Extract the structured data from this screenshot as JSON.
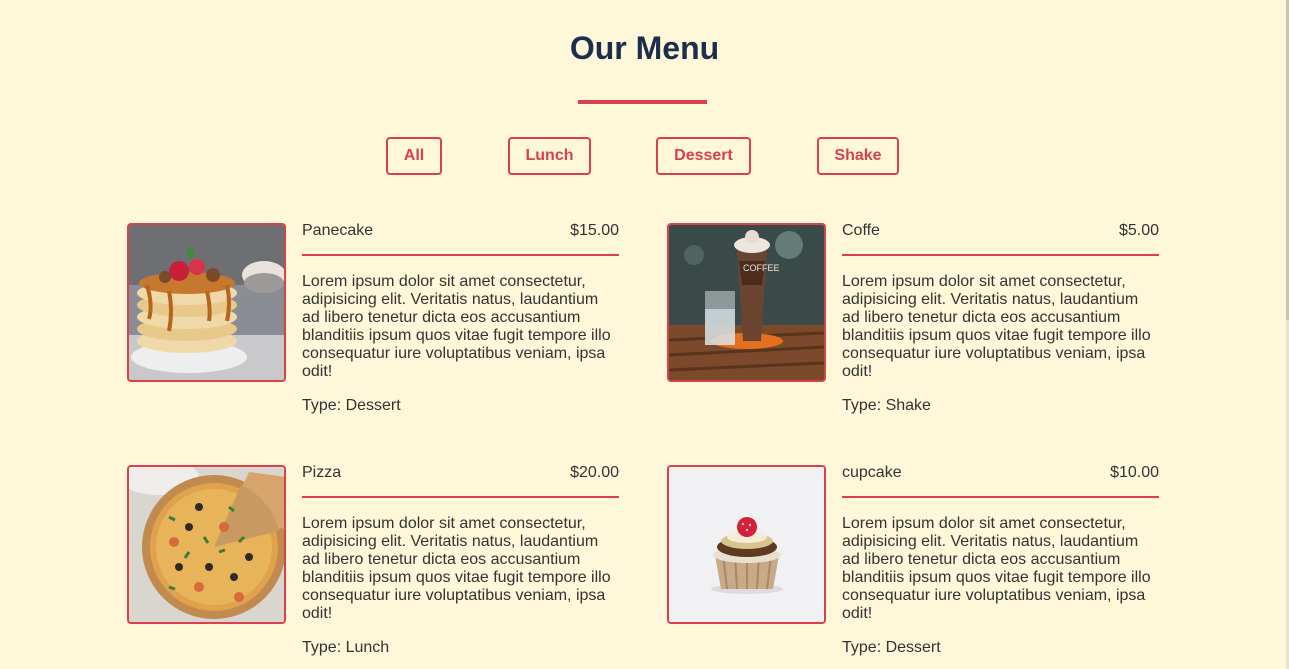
{
  "page": {
    "title": "Our Menu"
  },
  "filters": [
    "All",
    "Lunch",
    "Dessert",
    "Shake"
  ],
  "type_prefix": "Type: ",
  "items": [
    {
      "name": "Panecake",
      "price": "$15.00",
      "description": "Lorem ipsum dolor sit amet consectetur, adipisicing elit. Veritatis natus, laudantium ad libero tenetur dicta eos accusantium blanditiis ipsum quos vitae fugit tempore illo consequatur iure voluptatibus veniam, ipsa odit!",
      "type": "Type: Dessert",
      "image": "pancake-stack-photo"
    },
    {
      "name": "Coffe",
      "price": "$5.00",
      "description": "Lorem ipsum dolor sit amet consectetur, adipisicing elit. Veritatis natus, laudantium ad libero tenetur dicta eos accusantium blanditiis ipsum quos vitae fugit tempore illo consequatur iure voluptatibus veniam, ipsa odit!",
      "type": "Type: Shake",
      "image": "iced-coffee-photo"
    },
    {
      "name": "Pizza",
      "price": "$20.00",
      "description": "Lorem ipsum dolor sit amet consectetur, adipisicing elit. Veritatis natus, laudantium ad libero tenetur dicta eos accusantium blanditiis ipsum quos vitae fugit tempore illo consequatur iure voluptatibus veniam, ipsa odit!",
      "type": "Type: Lunch",
      "image": "pizza-photo"
    },
    {
      "name": "cupcake",
      "price": "$10.00",
      "description": "Lorem ipsum dolor sit amet consectetur, adipisicing elit. Veritatis natus, laudantium ad libero tenetur dicta eos accusantium blanditiis ipsum quos vitae fugit tempore illo consequatur iure voluptatibus veniam, ipsa odit!",
      "type": "Type: Dessert",
      "image": "cupcake-photo"
    }
  ],
  "colors": {
    "background": "#fff7d9",
    "accent": "#d9414b",
    "heading": "#1d2d4c",
    "text": "#333333"
  }
}
